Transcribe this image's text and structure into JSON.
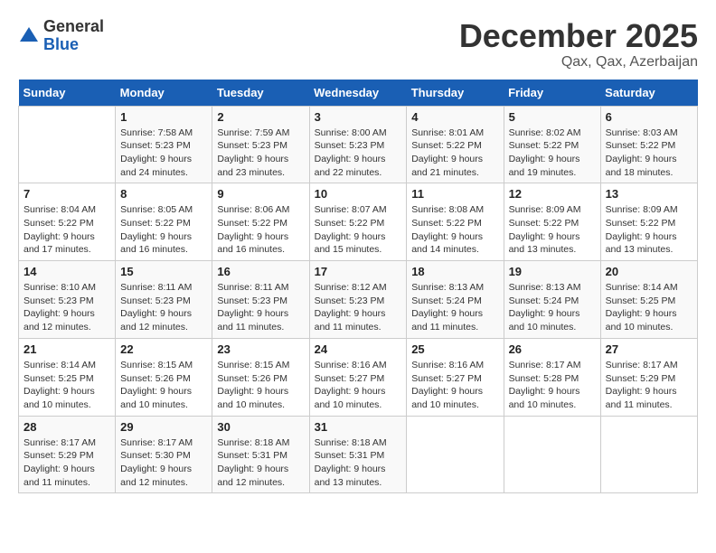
{
  "logo": {
    "general": "General",
    "blue": "Blue"
  },
  "title": "December 2025",
  "location": "Qax, Qax, Azerbaijan",
  "days_header": [
    "Sunday",
    "Monday",
    "Tuesday",
    "Wednesday",
    "Thursday",
    "Friday",
    "Saturday"
  ],
  "weeks": [
    [
      {
        "day": "",
        "info": ""
      },
      {
        "day": "1",
        "info": "Sunrise: 7:58 AM\nSunset: 5:23 PM\nDaylight: 9 hours\nand 24 minutes."
      },
      {
        "day": "2",
        "info": "Sunrise: 7:59 AM\nSunset: 5:23 PM\nDaylight: 9 hours\nand 23 minutes."
      },
      {
        "day": "3",
        "info": "Sunrise: 8:00 AM\nSunset: 5:23 PM\nDaylight: 9 hours\nand 22 minutes."
      },
      {
        "day": "4",
        "info": "Sunrise: 8:01 AM\nSunset: 5:22 PM\nDaylight: 9 hours\nand 21 minutes."
      },
      {
        "day": "5",
        "info": "Sunrise: 8:02 AM\nSunset: 5:22 PM\nDaylight: 9 hours\nand 19 minutes."
      },
      {
        "day": "6",
        "info": "Sunrise: 8:03 AM\nSunset: 5:22 PM\nDaylight: 9 hours\nand 18 minutes."
      }
    ],
    [
      {
        "day": "7",
        "info": "Sunrise: 8:04 AM\nSunset: 5:22 PM\nDaylight: 9 hours\nand 17 minutes."
      },
      {
        "day": "8",
        "info": "Sunrise: 8:05 AM\nSunset: 5:22 PM\nDaylight: 9 hours\nand 16 minutes."
      },
      {
        "day": "9",
        "info": "Sunrise: 8:06 AM\nSunset: 5:22 PM\nDaylight: 9 hours\nand 16 minutes."
      },
      {
        "day": "10",
        "info": "Sunrise: 8:07 AM\nSunset: 5:22 PM\nDaylight: 9 hours\nand 15 minutes."
      },
      {
        "day": "11",
        "info": "Sunrise: 8:08 AM\nSunset: 5:22 PM\nDaylight: 9 hours\nand 14 minutes."
      },
      {
        "day": "12",
        "info": "Sunrise: 8:09 AM\nSunset: 5:22 PM\nDaylight: 9 hours\nand 13 minutes."
      },
      {
        "day": "13",
        "info": "Sunrise: 8:09 AM\nSunset: 5:22 PM\nDaylight: 9 hours\nand 13 minutes."
      }
    ],
    [
      {
        "day": "14",
        "info": "Sunrise: 8:10 AM\nSunset: 5:23 PM\nDaylight: 9 hours\nand 12 minutes."
      },
      {
        "day": "15",
        "info": "Sunrise: 8:11 AM\nSunset: 5:23 PM\nDaylight: 9 hours\nand 12 minutes."
      },
      {
        "day": "16",
        "info": "Sunrise: 8:11 AM\nSunset: 5:23 PM\nDaylight: 9 hours\nand 11 minutes."
      },
      {
        "day": "17",
        "info": "Sunrise: 8:12 AM\nSunset: 5:23 PM\nDaylight: 9 hours\nand 11 minutes."
      },
      {
        "day": "18",
        "info": "Sunrise: 8:13 AM\nSunset: 5:24 PM\nDaylight: 9 hours\nand 11 minutes."
      },
      {
        "day": "19",
        "info": "Sunrise: 8:13 AM\nSunset: 5:24 PM\nDaylight: 9 hours\nand 10 minutes."
      },
      {
        "day": "20",
        "info": "Sunrise: 8:14 AM\nSunset: 5:25 PM\nDaylight: 9 hours\nand 10 minutes."
      }
    ],
    [
      {
        "day": "21",
        "info": "Sunrise: 8:14 AM\nSunset: 5:25 PM\nDaylight: 9 hours\nand 10 minutes."
      },
      {
        "day": "22",
        "info": "Sunrise: 8:15 AM\nSunset: 5:26 PM\nDaylight: 9 hours\nand 10 minutes."
      },
      {
        "day": "23",
        "info": "Sunrise: 8:15 AM\nSunset: 5:26 PM\nDaylight: 9 hours\nand 10 minutes."
      },
      {
        "day": "24",
        "info": "Sunrise: 8:16 AM\nSunset: 5:27 PM\nDaylight: 9 hours\nand 10 minutes."
      },
      {
        "day": "25",
        "info": "Sunrise: 8:16 AM\nSunset: 5:27 PM\nDaylight: 9 hours\nand 10 minutes."
      },
      {
        "day": "26",
        "info": "Sunrise: 8:17 AM\nSunset: 5:28 PM\nDaylight: 9 hours\nand 10 minutes."
      },
      {
        "day": "27",
        "info": "Sunrise: 8:17 AM\nSunset: 5:29 PM\nDaylight: 9 hours\nand 11 minutes."
      }
    ],
    [
      {
        "day": "28",
        "info": "Sunrise: 8:17 AM\nSunset: 5:29 PM\nDaylight: 9 hours\nand 11 minutes."
      },
      {
        "day": "29",
        "info": "Sunrise: 8:17 AM\nSunset: 5:30 PM\nDaylight: 9 hours\nand 12 minutes."
      },
      {
        "day": "30",
        "info": "Sunrise: 8:18 AM\nSunset: 5:31 PM\nDaylight: 9 hours\nand 12 minutes."
      },
      {
        "day": "31",
        "info": "Sunrise: 8:18 AM\nSunset: 5:31 PM\nDaylight: 9 hours\nand 13 minutes."
      },
      {
        "day": "",
        "info": ""
      },
      {
        "day": "",
        "info": ""
      },
      {
        "day": "",
        "info": ""
      }
    ]
  ]
}
